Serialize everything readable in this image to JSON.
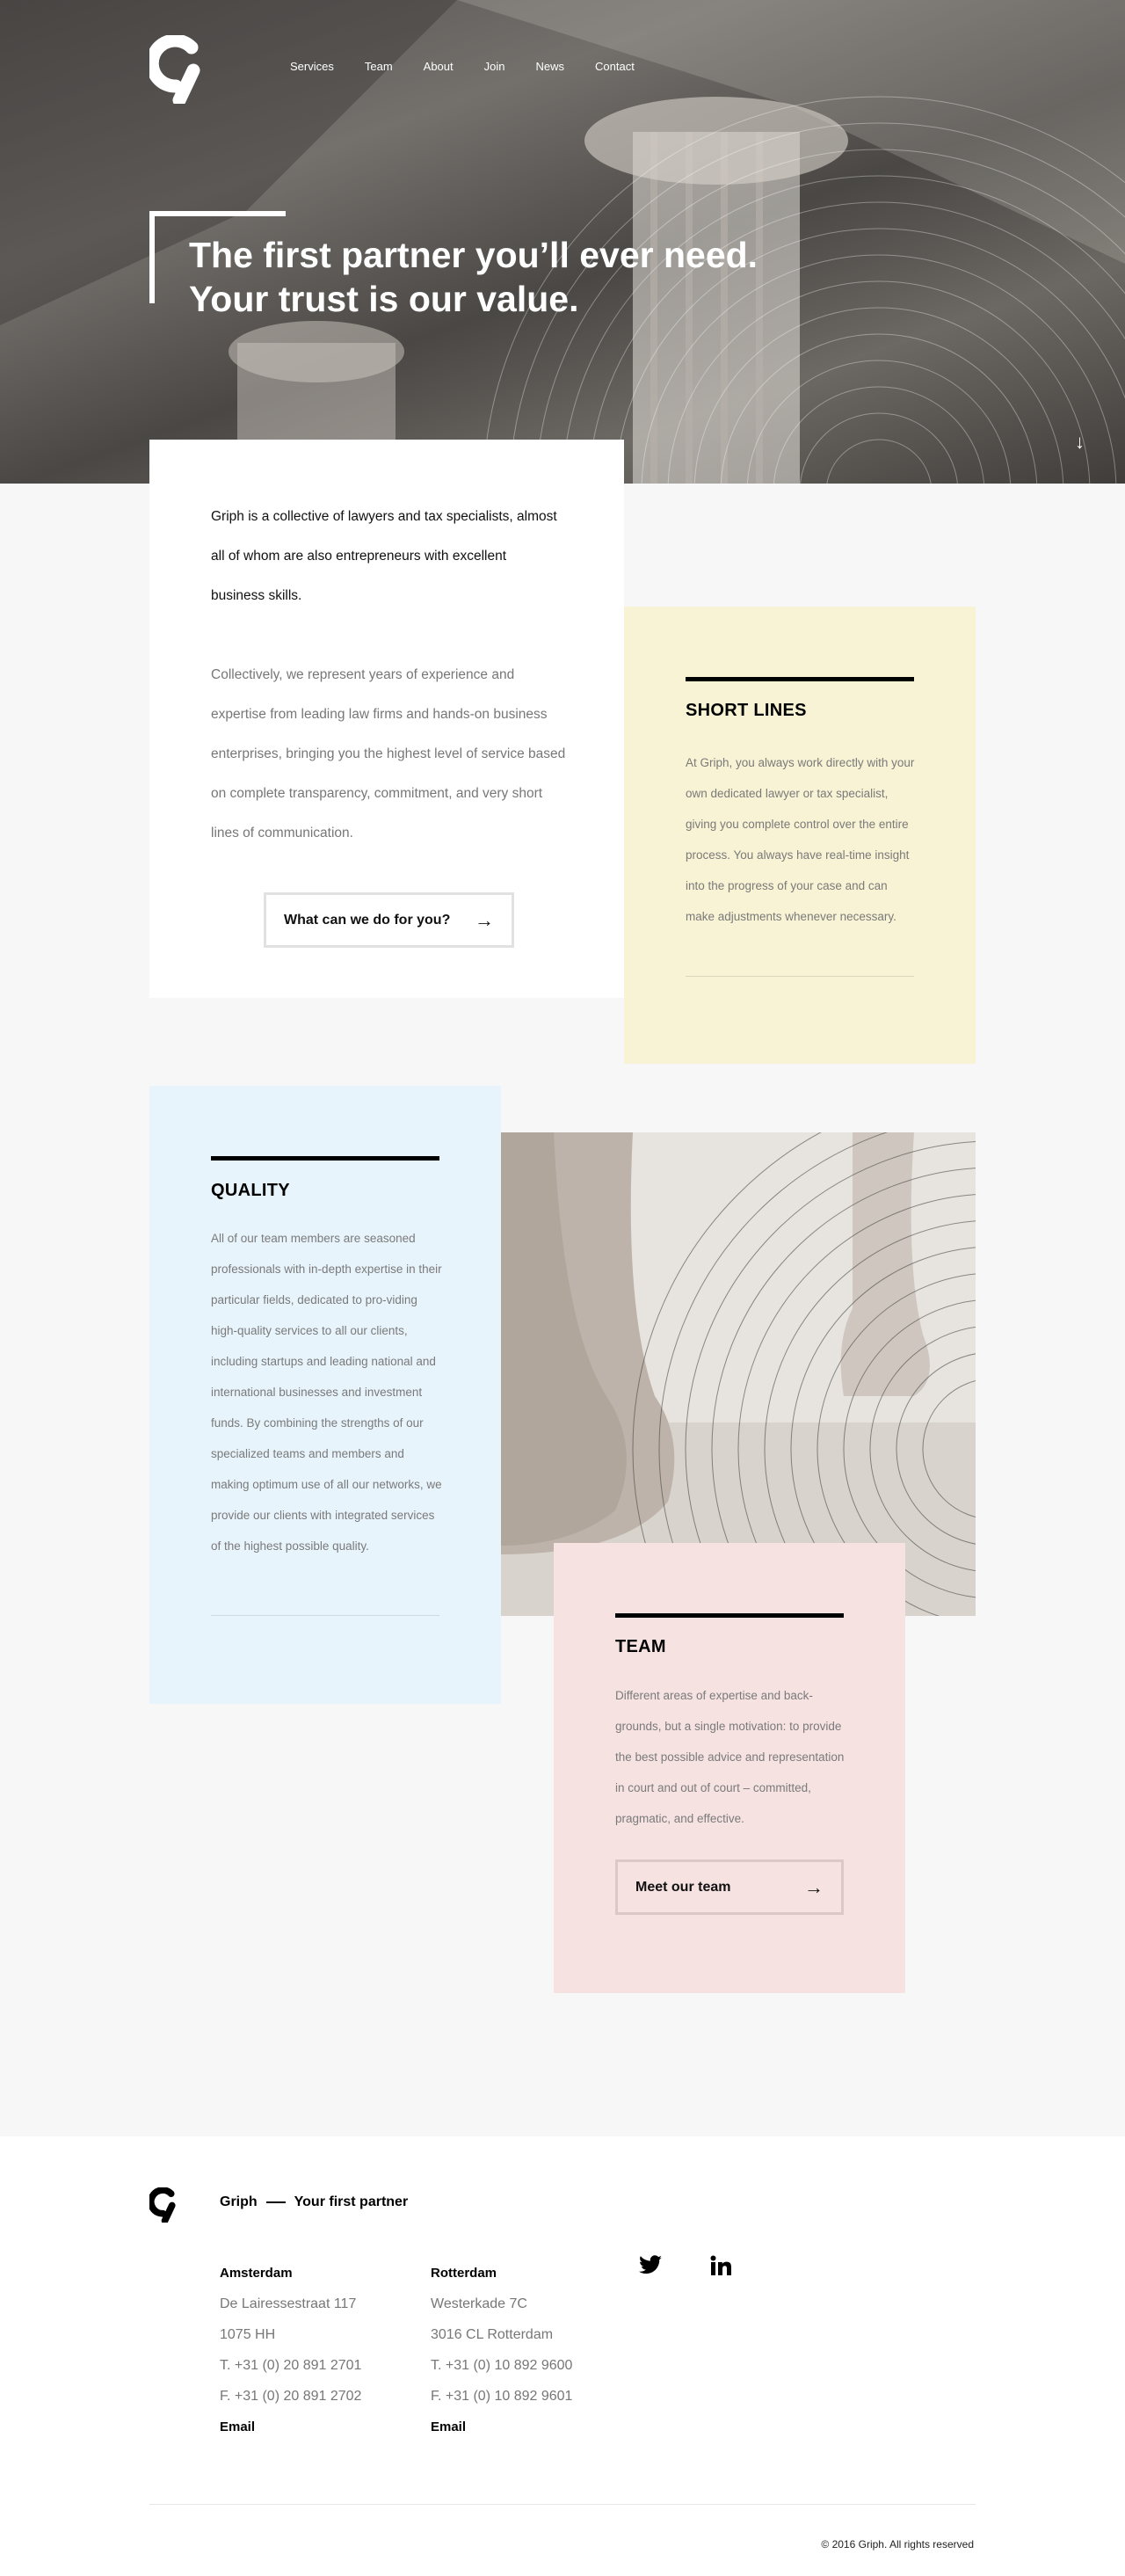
{
  "nav": {
    "items": [
      "Services",
      "Team",
      "About",
      "Join",
      "News",
      "Contact"
    ]
  },
  "hero": {
    "title_line1": "The first partner you’ll ever need.",
    "title_line2": "Your trust is our value.",
    "arrow_icon": "arrow-down-icon"
  },
  "intro": {
    "lead": "Griph is a collective of lawyers and tax specialists, almost all of whom are also entrepreneurs with excellent business skills.",
    "body": "Collectively, we represent years of experience and expertise from leading law firms and hands-on business enterprises, bringing you the highest level of service based on complete transparency, commitment, and very short lines of communication.",
    "cta": "What can we do for you?"
  },
  "short_lines": {
    "title": "SHORT LINES",
    "text": "At Griph, you always work directly with your own dedicated lawyer or tax specialist, giving you complete control over the entire process. You always have real-time insight into the progress of your case and can make adjustments whenever necessary."
  },
  "quality": {
    "title": "QUALITY",
    "text": "All of our team members are seasoned professionals with in-depth expertise in their particular fields, dedicated to pro-viding high-quality services to all our clients, including startups and leading national and international businesses and investment funds. By combining the strengths of our specialized teams and members and making optimum use of all our networks, we provide our clients with integrated services of the highest possible quality."
  },
  "team": {
    "title": "TEAM",
    "text": "Different areas of expertise and back-grounds, but a single motivation: to provide the best possible advice and representation in court and out of court – committed, pragmatic, and effective.",
    "cta": "Meet our team"
  },
  "footer": {
    "brand": "Griph",
    "tagline": "Your first partner",
    "amsterdam": {
      "city": "Amsterdam",
      "street": "De Lairessestraat 117",
      "postal": "1075 HH",
      "phone": "T. +31 (0) 20 891 2701",
      "fax": "F. +31 (0) 20 891 2702",
      "email": "Email"
    },
    "rotterdam": {
      "city": "Rotterdam",
      "street": "Westerkade 7C",
      "postal": "3016 CL Rotterdam",
      "phone": "T. +31 (0) 10 892 9600",
      "fax": "F. +31 (0) 10 892 9601",
      "email": "Email"
    },
    "social": {
      "twitter": "twitter-icon",
      "linkedin": "linkedin-icon"
    },
    "copyright": "© 2016 Griph. All rights reserved"
  },
  "colors": {
    "short_lines_bg": "#f8f3d4",
    "quality_bg": "#e8f4fc",
    "team_bg": "#f7e2e2",
    "page_bg": "#f7f7f7"
  }
}
